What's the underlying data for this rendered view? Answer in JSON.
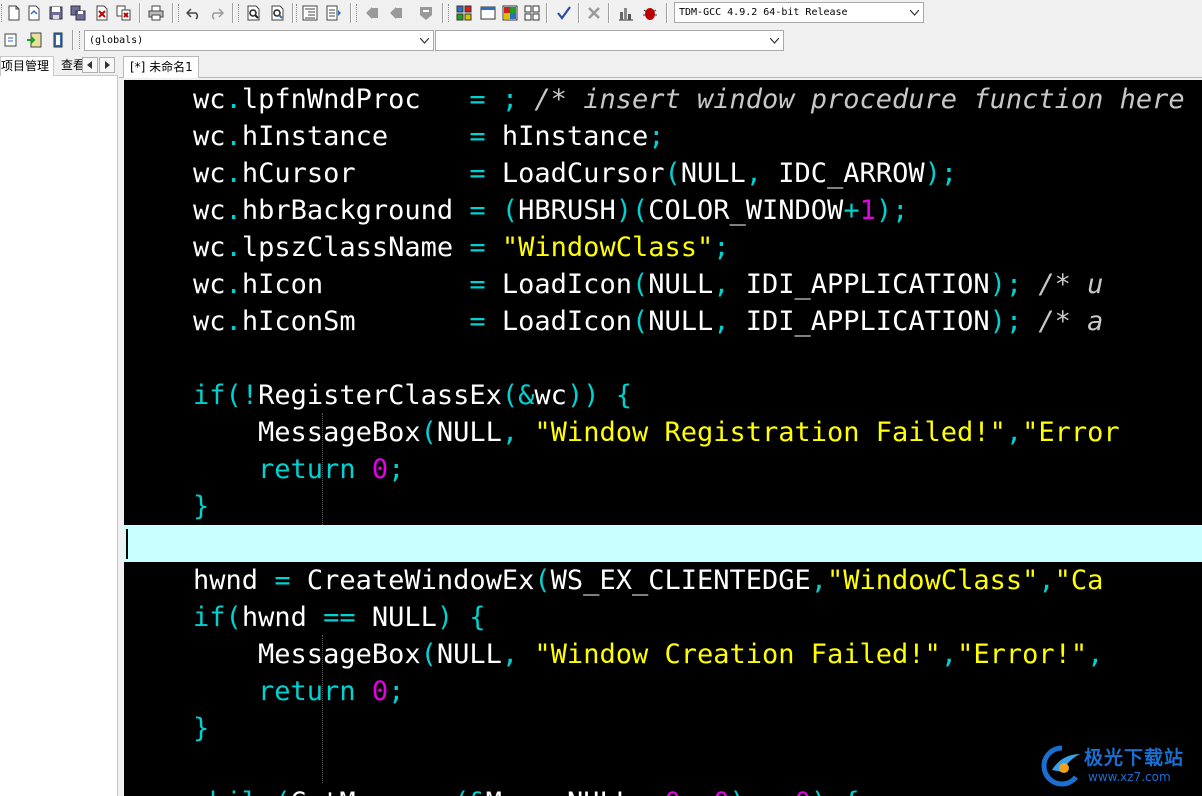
{
  "toolbar": {
    "compiler_select": "TDM-GCC 4.9.2 64-bit Release",
    "icons": [
      "new-file-icon",
      "open-file-icon",
      "save-icon",
      "save-all-icon",
      "close-file-icon",
      "close-all-icon",
      "print-icon",
      "undo-icon",
      "redo-icon",
      "find-icon",
      "replace-icon",
      "indent-icon",
      "unindent-icon",
      "bookmark-prev-icon",
      "bookmark-next-icon",
      "goto-icon",
      "compile-icon",
      "run-icon",
      "compile-run-icon",
      "rebuild-icon",
      "syntax-check-icon",
      "stop-icon",
      "chart-icon",
      "debug-icon"
    ]
  },
  "toolbar2": {
    "scope_select": "(globals)",
    "symbol_select": ""
  },
  "left_panel": {
    "tabs": [
      "项目管理",
      "查看"
    ]
  },
  "editor": {
    "file_tab": "[*] 未命名1",
    "colors": {
      "background": "#000000",
      "plain": "#ffffff",
      "operator": "#00d2d2",
      "keyword": "#00d2d2",
      "number": "#e600e6",
      "string": "#ffff00",
      "comment": "#c8c8c8",
      "active_line": "#c8ffff"
    },
    "lines": [
      [
        {
          "t": "    wc",
          "c": "plain"
        },
        {
          "t": ".",
          "c": "punc"
        },
        {
          "t": "lpfnWndProc   ",
          "c": "plain"
        },
        {
          "t": "= ; ",
          "c": "punc"
        },
        {
          "t": "/* insert window procedure function here */",
          "c": "cmt"
        }
      ],
      [
        {
          "t": "    wc",
          "c": "plain"
        },
        {
          "t": ".",
          "c": "punc"
        },
        {
          "t": "hInstance     ",
          "c": "plain"
        },
        {
          "t": "= ",
          "c": "punc"
        },
        {
          "t": "hInstance",
          "c": "plain"
        },
        {
          "t": ";",
          "c": "punc"
        }
      ],
      [
        {
          "t": "    wc",
          "c": "plain"
        },
        {
          "t": ".",
          "c": "punc"
        },
        {
          "t": "hCursor       ",
          "c": "plain"
        },
        {
          "t": "= ",
          "c": "punc"
        },
        {
          "t": "LoadCursor",
          "c": "plain"
        },
        {
          "t": "(",
          "c": "punc"
        },
        {
          "t": "NULL",
          "c": "plain"
        },
        {
          "t": ", ",
          "c": "punc"
        },
        {
          "t": "IDC_ARROW",
          "c": "plain"
        },
        {
          "t": ");",
          "c": "punc"
        }
      ],
      [
        {
          "t": "    wc",
          "c": "plain"
        },
        {
          "t": ".",
          "c": "punc"
        },
        {
          "t": "hbrBackground ",
          "c": "plain"
        },
        {
          "t": "= (",
          "c": "punc"
        },
        {
          "t": "HBRUSH",
          "c": "plain"
        },
        {
          "t": ")(",
          "c": "punc"
        },
        {
          "t": "COLOR_WINDOW",
          "c": "plain"
        },
        {
          "t": "+",
          "c": "punc"
        },
        {
          "t": "1",
          "c": "num"
        },
        {
          "t": ");",
          "c": "punc"
        }
      ],
      [
        {
          "t": "    wc",
          "c": "plain"
        },
        {
          "t": ".",
          "c": "punc"
        },
        {
          "t": "lpszClassName ",
          "c": "plain"
        },
        {
          "t": "= ",
          "c": "punc"
        },
        {
          "t": "\"WindowClass\"",
          "c": "str"
        },
        {
          "t": ";",
          "c": "punc"
        }
      ],
      [
        {
          "t": "    wc",
          "c": "plain"
        },
        {
          "t": ".",
          "c": "punc"
        },
        {
          "t": "hIcon         ",
          "c": "plain"
        },
        {
          "t": "= ",
          "c": "punc"
        },
        {
          "t": "LoadIcon",
          "c": "plain"
        },
        {
          "t": "(",
          "c": "punc"
        },
        {
          "t": "NULL",
          "c": "plain"
        },
        {
          "t": ", ",
          "c": "punc"
        },
        {
          "t": "IDI_APPLICATION",
          "c": "plain"
        },
        {
          "t": "); ",
          "c": "punc"
        },
        {
          "t": "/* u",
          "c": "cmt"
        }
      ],
      [
        {
          "t": "    wc",
          "c": "plain"
        },
        {
          "t": ".",
          "c": "punc"
        },
        {
          "t": "hIconSm       ",
          "c": "plain"
        },
        {
          "t": "= ",
          "c": "punc"
        },
        {
          "t": "LoadIcon",
          "c": "plain"
        },
        {
          "t": "(",
          "c": "punc"
        },
        {
          "t": "NULL",
          "c": "plain"
        },
        {
          "t": ", ",
          "c": "punc"
        },
        {
          "t": "IDI_APPLICATION",
          "c": "plain"
        },
        {
          "t": "); ",
          "c": "punc"
        },
        {
          "t": "/* a",
          "c": "cmt"
        }
      ],
      [],
      [
        {
          "t": "    if",
          "c": "kw"
        },
        {
          "t": "(!",
          "c": "punc"
        },
        {
          "t": "RegisterClassEx",
          "c": "plain"
        },
        {
          "t": "(&",
          "c": "punc"
        },
        {
          "t": "wc",
          "c": "plain"
        },
        {
          "t": ")) {",
          "c": "punc"
        }
      ],
      [
        {
          "t": "        MessageBox",
          "c": "plain"
        },
        {
          "t": "(",
          "c": "punc"
        },
        {
          "t": "NULL",
          "c": "plain"
        },
        {
          "t": ", ",
          "c": "punc"
        },
        {
          "t": "\"Window Registration Failed!\"",
          "c": "str"
        },
        {
          "t": ",",
          "c": "punc"
        },
        {
          "t": "\"Error",
          "c": "str"
        }
      ],
      [
        {
          "t": "        return ",
          "c": "kw"
        },
        {
          "t": "0",
          "c": "num"
        },
        {
          "t": ";",
          "c": "punc"
        }
      ],
      [
        {
          "t": "    }",
          "c": "punc"
        }
      ],
      [],
      [
        {
          "t": "    hwnd ",
          "c": "plain"
        },
        {
          "t": "= ",
          "c": "punc"
        },
        {
          "t": "CreateWindowEx",
          "c": "plain"
        },
        {
          "t": "(",
          "c": "punc"
        },
        {
          "t": "WS_EX_CLIENTEDGE",
          "c": "plain"
        },
        {
          "t": ",",
          "c": "punc"
        },
        {
          "t": "\"WindowClass\"",
          "c": "str"
        },
        {
          "t": ",",
          "c": "punc"
        },
        {
          "t": "\"Ca",
          "c": "str"
        }
      ],
      [
        {
          "t": "    if",
          "c": "kw"
        },
        {
          "t": "(",
          "c": "punc"
        },
        {
          "t": "hwnd ",
          "c": "plain"
        },
        {
          "t": "== ",
          "c": "punc"
        },
        {
          "t": "NULL",
          "c": "plain"
        },
        {
          "t": ") {",
          "c": "punc"
        }
      ],
      [
        {
          "t": "        MessageBox",
          "c": "plain"
        },
        {
          "t": "(",
          "c": "punc"
        },
        {
          "t": "NULL",
          "c": "plain"
        },
        {
          "t": ", ",
          "c": "punc"
        },
        {
          "t": "\"Window Creation Failed!\"",
          "c": "str"
        },
        {
          "t": ",",
          "c": "punc"
        },
        {
          "t": "\"Error!\"",
          "c": "str"
        },
        {
          "t": ",",
          "c": "punc"
        }
      ],
      [
        {
          "t": "        return ",
          "c": "kw"
        },
        {
          "t": "0",
          "c": "num"
        },
        {
          "t": ";",
          "c": "punc"
        }
      ],
      [
        {
          "t": "    }",
          "c": "punc"
        }
      ],
      [],
      [
        {
          "t": "    while",
          "c": "kw"
        },
        {
          "t": "(",
          "c": "punc"
        },
        {
          "t": "GetMessage",
          "c": "plain"
        },
        {
          "t": "(&",
          "c": "punc"
        },
        {
          "t": "Msg",
          "c": "plain"
        },
        {
          "t": ", ",
          "c": "punc"
        },
        {
          "t": "NULL",
          "c": "plain"
        },
        {
          "t": ", ",
          "c": "punc"
        },
        {
          "t": "0",
          "c": "num"
        },
        {
          "t": ", ",
          "c": "punc"
        },
        {
          "t": "0",
          "c": "num"
        },
        {
          "t": ") > ",
          "c": "punc"
        },
        {
          "t": "0",
          "c": "num"
        },
        {
          "t": ") {",
          "c": "punc"
        }
      ]
    ],
    "active_line_index": 12
  },
  "watermark": {
    "text": "极光下载站",
    "url": "www.xz7.com"
  }
}
